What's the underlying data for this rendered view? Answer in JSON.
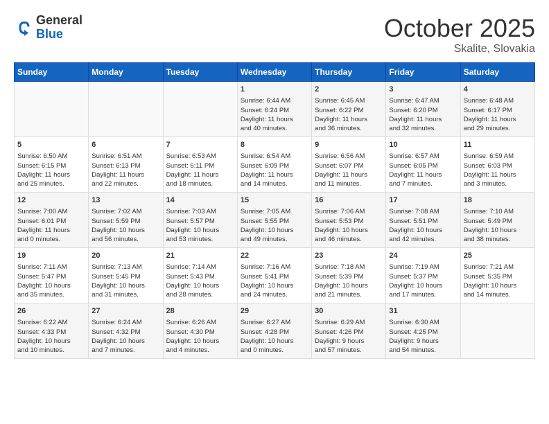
{
  "header": {
    "logo_general": "General",
    "logo_blue": "Blue",
    "month": "October 2025",
    "location": "Skalite, Slovakia"
  },
  "days_of_week": [
    "Sunday",
    "Monday",
    "Tuesday",
    "Wednesday",
    "Thursday",
    "Friday",
    "Saturday"
  ],
  "weeks": [
    [
      {
        "num": "",
        "info": ""
      },
      {
        "num": "",
        "info": ""
      },
      {
        "num": "",
        "info": ""
      },
      {
        "num": "1",
        "info": "Sunrise: 6:44 AM\nSunset: 6:24 PM\nDaylight: 11 hours\nand 40 minutes."
      },
      {
        "num": "2",
        "info": "Sunrise: 6:45 AM\nSunset: 6:22 PM\nDaylight: 11 hours\nand 36 minutes."
      },
      {
        "num": "3",
        "info": "Sunrise: 6:47 AM\nSunset: 6:20 PM\nDaylight: 11 hours\nand 32 minutes."
      },
      {
        "num": "4",
        "info": "Sunrise: 6:48 AM\nSunset: 6:17 PM\nDaylight: 11 hours\nand 29 minutes."
      }
    ],
    [
      {
        "num": "5",
        "info": "Sunrise: 6:50 AM\nSunset: 6:15 PM\nDaylight: 11 hours\nand 25 minutes."
      },
      {
        "num": "6",
        "info": "Sunrise: 6:51 AM\nSunset: 6:13 PM\nDaylight: 11 hours\nand 22 minutes."
      },
      {
        "num": "7",
        "info": "Sunrise: 6:53 AM\nSunset: 6:11 PM\nDaylight: 11 hours\nand 18 minutes."
      },
      {
        "num": "8",
        "info": "Sunrise: 6:54 AM\nSunset: 6:09 PM\nDaylight: 11 hours\nand 14 minutes."
      },
      {
        "num": "9",
        "info": "Sunrise: 6:56 AM\nSunset: 6:07 PM\nDaylight: 11 hours\nand 11 minutes."
      },
      {
        "num": "10",
        "info": "Sunrise: 6:57 AM\nSunset: 6:05 PM\nDaylight: 11 hours\nand 7 minutes."
      },
      {
        "num": "11",
        "info": "Sunrise: 6:59 AM\nSunset: 6:03 PM\nDaylight: 11 hours\nand 3 minutes."
      }
    ],
    [
      {
        "num": "12",
        "info": "Sunrise: 7:00 AM\nSunset: 6:01 PM\nDaylight: 11 hours\nand 0 minutes."
      },
      {
        "num": "13",
        "info": "Sunrise: 7:02 AM\nSunset: 5:59 PM\nDaylight: 10 hours\nand 56 minutes."
      },
      {
        "num": "14",
        "info": "Sunrise: 7:03 AM\nSunset: 5:57 PM\nDaylight: 10 hours\nand 53 minutes."
      },
      {
        "num": "15",
        "info": "Sunrise: 7:05 AM\nSunset: 5:55 PM\nDaylight: 10 hours\nand 49 minutes."
      },
      {
        "num": "16",
        "info": "Sunrise: 7:06 AM\nSunset: 5:53 PM\nDaylight: 10 hours\nand 46 minutes."
      },
      {
        "num": "17",
        "info": "Sunrise: 7:08 AM\nSunset: 5:51 PM\nDaylight: 10 hours\nand 42 minutes."
      },
      {
        "num": "18",
        "info": "Sunrise: 7:10 AM\nSunset: 5:49 PM\nDaylight: 10 hours\nand 38 minutes."
      }
    ],
    [
      {
        "num": "19",
        "info": "Sunrise: 7:11 AM\nSunset: 5:47 PM\nDaylight: 10 hours\nand 35 minutes."
      },
      {
        "num": "20",
        "info": "Sunrise: 7:13 AM\nSunset: 5:45 PM\nDaylight: 10 hours\nand 31 minutes."
      },
      {
        "num": "21",
        "info": "Sunrise: 7:14 AM\nSunset: 5:43 PM\nDaylight: 10 hours\nand 28 minutes."
      },
      {
        "num": "22",
        "info": "Sunrise: 7:16 AM\nSunset: 5:41 PM\nDaylight: 10 hours\nand 24 minutes."
      },
      {
        "num": "23",
        "info": "Sunrise: 7:18 AM\nSunset: 5:39 PM\nDaylight: 10 hours\nand 21 minutes."
      },
      {
        "num": "24",
        "info": "Sunrise: 7:19 AM\nSunset: 5:37 PM\nDaylight: 10 hours\nand 17 minutes."
      },
      {
        "num": "25",
        "info": "Sunrise: 7:21 AM\nSunset: 5:35 PM\nDaylight: 10 hours\nand 14 minutes."
      }
    ],
    [
      {
        "num": "26",
        "info": "Sunrise: 6:22 AM\nSunset: 4:33 PM\nDaylight: 10 hours\nand 10 minutes."
      },
      {
        "num": "27",
        "info": "Sunrise: 6:24 AM\nSunset: 4:32 PM\nDaylight: 10 hours\nand 7 minutes."
      },
      {
        "num": "28",
        "info": "Sunrise: 6:26 AM\nSunset: 4:30 PM\nDaylight: 10 hours\nand 4 minutes."
      },
      {
        "num": "29",
        "info": "Sunrise: 6:27 AM\nSunset: 4:28 PM\nDaylight: 10 hours\nand 0 minutes."
      },
      {
        "num": "30",
        "info": "Sunrise: 6:29 AM\nSunset: 4:26 PM\nDaylight: 9 hours\nand 57 minutes."
      },
      {
        "num": "31",
        "info": "Sunrise: 6:30 AM\nSunset: 4:25 PM\nDaylight: 9 hours\nand 54 minutes."
      },
      {
        "num": "",
        "info": ""
      }
    ]
  ]
}
